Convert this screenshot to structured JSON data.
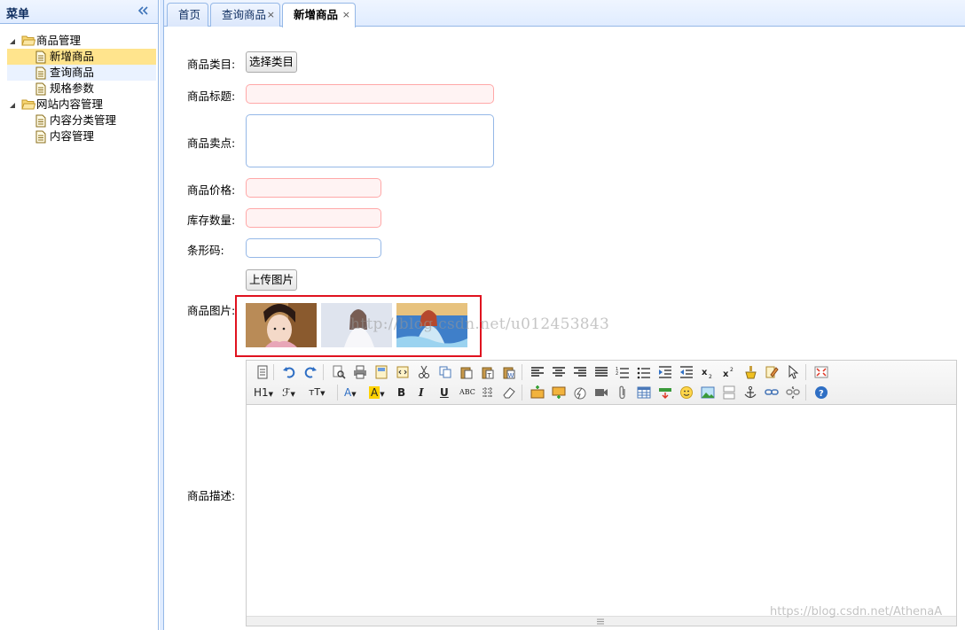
{
  "sidebar": {
    "title": "菜单",
    "collapse_icon": "double-chevron-left-icon",
    "tree": [
      {
        "label": "商品管理",
        "level": 1,
        "icon": "folder-open-icon"
      },
      {
        "label": "新增商品",
        "level": 2,
        "icon": "file-icon",
        "selected": true
      },
      {
        "label": "查询商品",
        "level": 2,
        "icon": "file-icon"
      },
      {
        "label": "规格参数",
        "level": 2,
        "icon": "file-icon"
      },
      {
        "label": "网站内容管理",
        "level": 1,
        "icon": "folder-open-icon"
      },
      {
        "label": "内容分类管理",
        "level": 2,
        "icon": "file-icon"
      },
      {
        "label": "内容管理",
        "level": 2,
        "icon": "file-icon"
      }
    ]
  },
  "tabs": [
    {
      "label": "首页",
      "closable": false
    },
    {
      "label": "查询商品",
      "closable": true,
      "close": "×"
    },
    {
      "label": "新增商品",
      "closable": true,
      "close": "×",
      "active": true
    }
  ],
  "form": {
    "category": {
      "label": "商品类目:",
      "button": "选择类目"
    },
    "title": {
      "label": "商品标题:",
      "value": ""
    },
    "sell_point": {
      "label": "商品卖点:",
      "value": ""
    },
    "price": {
      "label": "商品价格:",
      "value": ""
    },
    "stock": {
      "label": "库存数量:",
      "value": ""
    },
    "barcode": {
      "label": "条形码:",
      "value": ""
    },
    "image": {
      "label": "商品图片:",
      "button": "上传图片",
      "thumbnails": 3
    },
    "description": {
      "label": "商品描述:",
      "value": ""
    }
  },
  "editor_toolbar": {
    "heading": "H1",
    "font_family": "ℱ",
    "font_size": "тT",
    "font_color": "A",
    "bg_color": "A",
    "bold": "B",
    "italic": "I",
    "underline": "U",
    "strikethrough": "ABC"
  },
  "watermarks": {
    "center": "http://blog.csdn.net/u012453843",
    "bottom": "https://blog.csdn.net/AthenaA"
  },
  "colors": {
    "panel_border": "#95b8e7",
    "selected_bg": "#ffe48d",
    "invalid_bg": "#fff3f3",
    "highlight_border": "#e0121f"
  }
}
